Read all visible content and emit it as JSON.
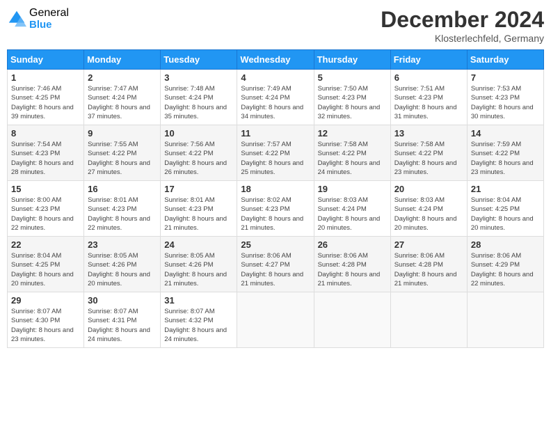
{
  "logo": {
    "general": "General",
    "blue": "Blue"
  },
  "title": "December 2024",
  "location": "Klosterlechfeld, Germany",
  "days_of_week": [
    "Sunday",
    "Monday",
    "Tuesday",
    "Wednesday",
    "Thursday",
    "Friday",
    "Saturday"
  ],
  "weeks": [
    [
      {
        "day": "1",
        "sunrise": "7:46 AM",
        "sunset": "4:25 PM",
        "daylight": "8 hours and 39 minutes."
      },
      {
        "day": "2",
        "sunrise": "7:47 AM",
        "sunset": "4:24 PM",
        "daylight": "8 hours and 37 minutes."
      },
      {
        "day": "3",
        "sunrise": "7:48 AM",
        "sunset": "4:24 PM",
        "daylight": "8 hours and 35 minutes."
      },
      {
        "day": "4",
        "sunrise": "7:49 AM",
        "sunset": "4:24 PM",
        "daylight": "8 hours and 34 minutes."
      },
      {
        "day": "5",
        "sunrise": "7:50 AM",
        "sunset": "4:23 PM",
        "daylight": "8 hours and 32 minutes."
      },
      {
        "day": "6",
        "sunrise": "7:51 AM",
        "sunset": "4:23 PM",
        "daylight": "8 hours and 31 minutes."
      },
      {
        "day": "7",
        "sunrise": "7:53 AM",
        "sunset": "4:23 PM",
        "daylight": "8 hours and 30 minutes."
      }
    ],
    [
      {
        "day": "8",
        "sunrise": "7:54 AM",
        "sunset": "4:23 PM",
        "daylight": "8 hours and 28 minutes."
      },
      {
        "day": "9",
        "sunrise": "7:55 AM",
        "sunset": "4:22 PM",
        "daylight": "8 hours and 27 minutes."
      },
      {
        "day": "10",
        "sunrise": "7:56 AM",
        "sunset": "4:22 PM",
        "daylight": "8 hours and 26 minutes."
      },
      {
        "day": "11",
        "sunrise": "7:57 AM",
        "sunset": "4:22 PM",
        "daylight": "8 hours and 25 minutes."
      },
      {
        "day": "12",
        "sunrise": "7:58 AM",
        "sunset": "4:22 PM",
        "daylight": "8 hours and 24 minutes."
      },
      {
        "day": "13",
        "sunrise": "7:58 AM",
        "sunset": "4:22 PM",
        "daylight": "8 hours and 23 minutes."
      },
      {
        "day": "14",
        "sunrise": "7:59 AM",
        "sunset": "4:22 PM",
        "daylight": "8 hours and 23 minutes."
      }
    ],
    [
      {
        "day": "15",
        "sunrise": "8:00 AM",
        "sunset": "4:23 PM",
        "daylight": "8 hours and 22 minutes."
      },
      {
        "day": "16",
        "sunrise": "8:01 AM",
        "sunset": "4:23 PM",
        "daylight": "8 hours and 22 minutes."
      },
      {
        "day": "17",
        "sunrise": "8:01 AM",
        "sunset": "4:23 PM",
        "daylight": "8 hours and 21 minutes."
      },
      {
        "day": "18",
        "sunrise": "8:02 AM",
        "sunset": "4:23 PM",
        "daylight": "8 hours and 21 minutes."
      },
      {
        "day": "19",
        "sunrise": "8:03 AM",
        "sunset": "4:24 PM",
        "daylight": "8 hours and 20 minutes."
      },
      {
        "day": "20",
        "sunrise": "8:03 AM",
        "sunset": "4:24 PM",
        "daylight": "8 hours and 20 minutes."
      },
      {
        "day": "21",
        "sunrise": "8:04 AM",
        "sunset": "4:25 PM",
        "daylight": "8 hours and 20 minutes."
      }
    ],
    [
      {
        "day": "22",
        "sunrise": "8:04 AM",
        "sunset": "4:25 PM",
        "daylight": "8 hours and 20 minutes."
      },
      {
        "day": "23",
        "sunrise": "8:05 AM",
        "sunset": "4:26 PM",
        "daylight": "8 hours and 20 minutes."
      },
      {
        "day": "24",
        "sunrise": "8:05 AM",
        "sunset": "4:26 PM",
        "daylight": "8 hours and 21 minutes."
      },
      {
        "day": "25",
        "sunrise": "8:06 AM",
        "sunset": "4:27 PM",
        "daylight": "8 hours and 21 minutes."
      },
      {
        "day": "26",
        "sunrise": "8:06 AM",
        "sunset": "4:28 PM",
        "daylight": "8 hours and 21 minutes."
      },
      {
        "day": "27",
        "sunrise": "8:06 AM",
        "sunset": "4:28 PM",
        "daylight": "8 hours and 21 minutes."
      },
      {
        "day": "28",
        "sunrise": "8:06 AM",
        "sunset": "4:29 PM",
        "daylight": "8 hours and 22 minutes."
      }
    ],
    [
      {
        "day": "29",
        "sunrise": "8:07 AM",
        "sunset": "4:30 PM",
        "daylight": "8 hours and 23 minutes."
      },
      {
        "day": "30",
        "sunrise": "8:07 AM",
        "sunset": "4:31 PM",
        "daylight": "8 hours and 24 minutes."
      },
      {
        "day": "31",
        "sunrise": "8:07 AM",
        "sunset": "4:32 PM",
        "daylight": "8 hours and 24 minutes."
      },
      null,
      null,
      null,
      null
    ]
  ],
  "labels": {
    "sunrise": "Sunrise:",
    "sunset": "Sunset:",
    "daylight": "Daylight:"
  }
}
